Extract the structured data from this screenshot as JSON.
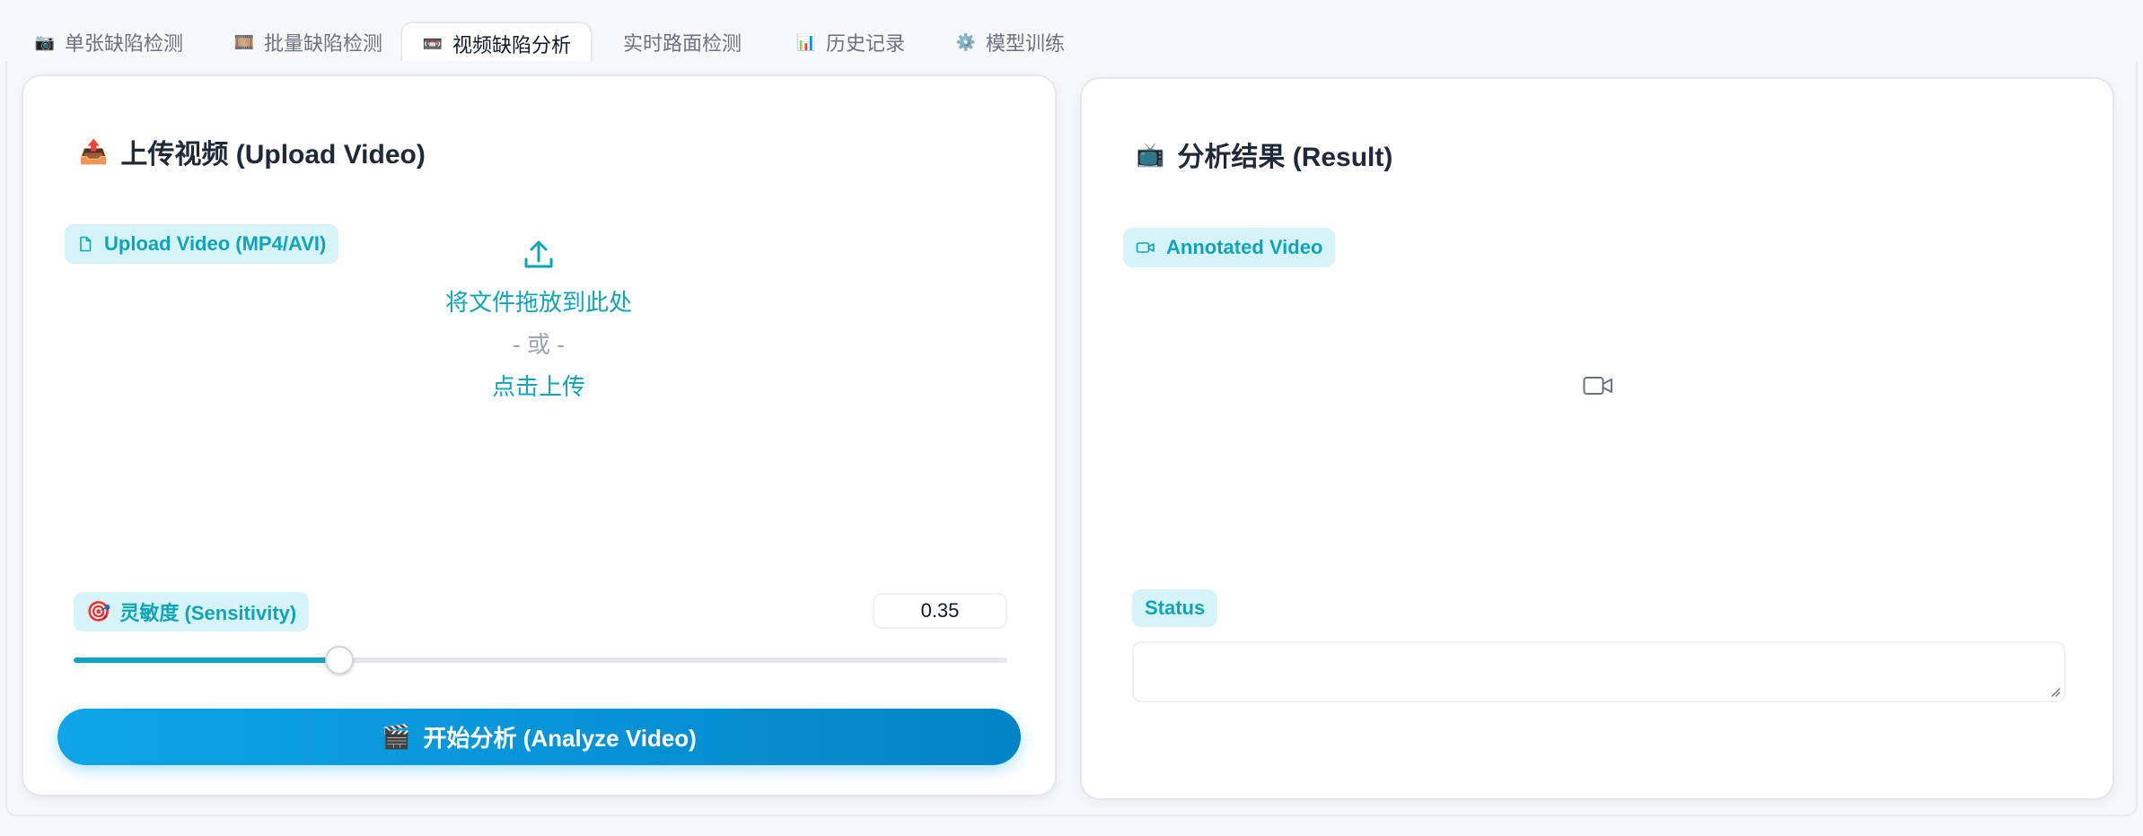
{
  "tabs": [
    {
      "icon": "📷",
      "label": "单张缺陷检测"
    },
    {
      "icon": "🎞️",
      "label": "批量缺陷检测"
    },
    {
      "icon": "📼",
      "label": "视频缺陷分析"
    },
    {
      "icon": "",
      "label": "实时路面检测"
    },
    {
      "icon": "📊",
      "label": "历史记录"
    },
    {
      "icon": "⚙️",
      "label": "模型训练"
    }
  ],
  "active_tab": 2,
  "upload_panel": {
    "title_emoji": "📤",
    "title": "上传视频 (Upload Video)",
    "upload_label": "Upload Video (MP4/AVI)",
    "dropzone": {
      "primary": "将文件拖放到此处",
      "or": "- 或 -",
      "click": "点击上传"
    },
    "sensitivity": {
      "emoji": "🎯",
      "label": "灵敏度 (Sensitivity)",
      "value": "0.35",
      "fraction": 0.285
    },
    "analyze_button": {
      "emoji": "🎬",
      "label": "开始分析 (Analyze Video)"
    }
  },
  "result_panel": {
    "title_emoji": "📺",
    "title": "分析结果 (Result)",
    "video_label": "Annotated Video",
    "status_label": "Status",
    "status_value": ""
  },
  "colors": {
    "accent": "#0ea5b7",
    "chip_bg": "#d6f3f7",
    "button_start": "#0ea5e9",
    "button_end": "#0284c7"
  }
}
